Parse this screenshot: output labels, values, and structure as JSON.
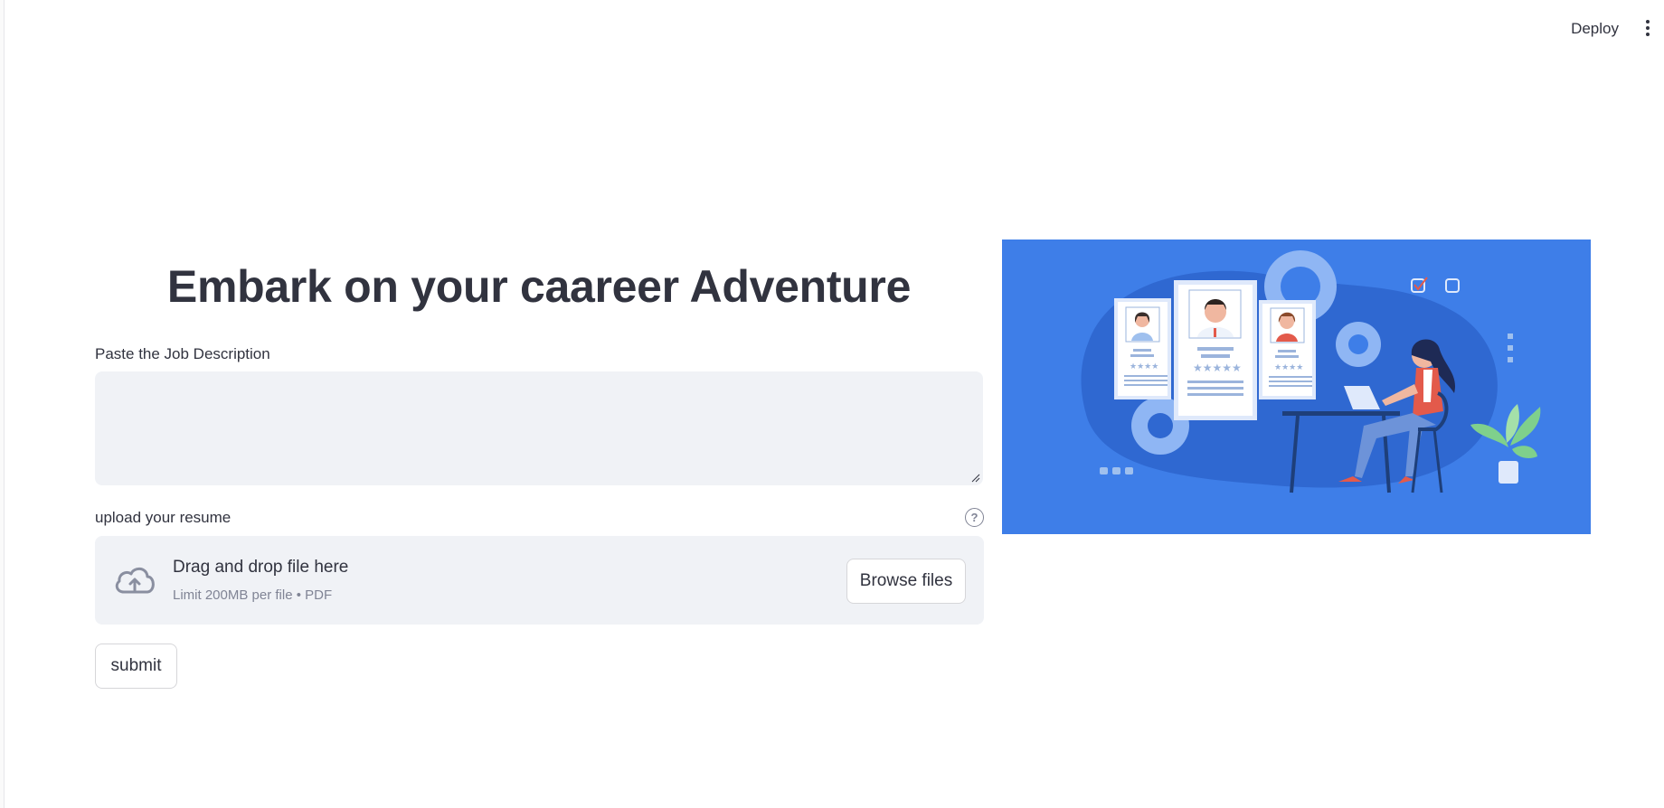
{
  "header": {
    "deploy_label": "Deploy",
    "menu_icon": "vertical-ellipsis-icon"
  },
  "main": {
    "title": "Embark on your caareer Adventure",
    "job_description": {
      "label": "Paste the Job Description",
      "value": "",
      "placeholder": ""
    },
    "upload": {
      "label": "upload your resume",
      "help_icon": "question-circle-icon",
      "drop_title": "Drag and drop file here",
      "drop_limit": "Limit 200MB per file • PDF",
      "browse_label": "Browse files",
      "upload_icon": "cloud-upload-icon"
    },
    "submit_label": "submit"
  },
  "hero": {
    "image_icon": "recruitment-illustration",
    "background_color": "#3e7ee8"
  },
  "colors": {
    "text": "#31333f",
    "muted": "#808495",
    "input_bg": "#f0f2f6"
  }
}
